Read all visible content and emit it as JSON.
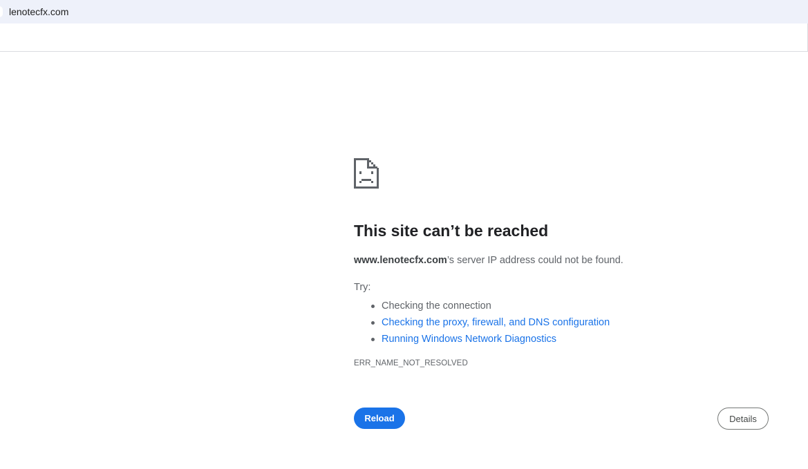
{
  "omnibox": {
    "url": "lenotecfx.com"
  },
  "error": {
    "headline": "This site can’t be reached",
    "host": "www.lenotecfx.com",
    "summary_suffix": "’s server IP address could not be found.",
    "try_label": "Try:",
    "suggestions": [
      {
        "text": "Checking the connection",
        "link": false
      },
      {
        "text": "Checking the proxy, firewall, and DNS configuration",
        "link": true
      },
      {
        "text": "Running Windows Network Diagnostics",
        "link": true
      }
    ],
    "code": "ERR_NAME_NOT_RESOLVED",
    "icon": "sad-page-icon"
  },
  "buttons": {
    "reload_label": "Reload",
    "details_label": "Details"
  },
  "colors": {
    "accent": "#1a73e8",
    "omnibox_bg": "#eef1fa",
    "text": "#202124",
    "secondary_text": "#5f6368"
  }
}
